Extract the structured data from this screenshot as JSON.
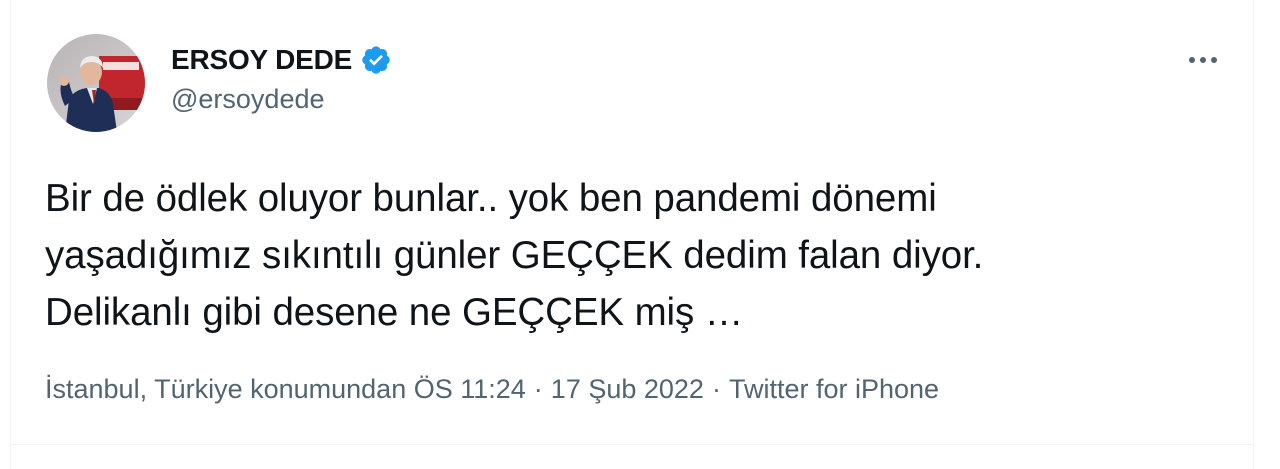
{
  "user": {
    "display_name": "ERSOY DEDE",
    "handle": "@ersoydede",
    "verified": true,
    "avatar_icon": "profile-photo"
  },
  "tweet": {
    "lines": [
      "Bir de ödlek oluyor bunlar.. yok ben pandemi dönemi",
      "yaşadığımız sıkıntılı günler GEÇÇEK dedim falan diyor.",
      "Delikanlı gibi desene ne GEÇÇEK miş …"
    ]
  },
  "meta": {
    "location_time": "İstanbul, Türkiye konumundan ÖS 11:24",
    "separator": "·",
    "date": "17 Şub 2022",
    "source": "Twitter for iPhone"
  },
  "colors": {
    "verified_blue": "#1d9bf0",
    "text_primary": "#0f1419",
    "text_secondary": "#536471"
  },
  "icons": {
    "verified": "verified-badge-icon",
    "more": "more-options-icon"
  }
}
